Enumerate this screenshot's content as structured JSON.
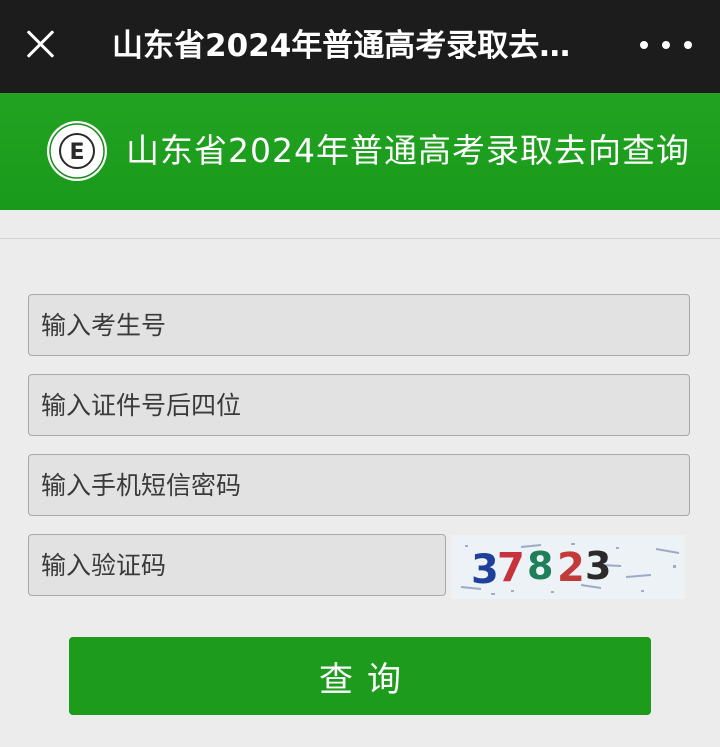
{
  "titlebar": {
    "title": "山东省2024年普通高考录取去…",
    "close_icon": "close-icon",
    "more_icon": "more-icon"
  },
  "banner": {
    "title": "山东省2024年普通高考录取去向查询",
    "logo_icon": "exam-authority-logo",
    "logo_letter": "E"
  },
  "form": {
    "exam_number_placeholder": "输入考生号",
    "id_last4_placeholder": "输入证件号后四位",
    "sms_password_placeholder": "输入手机短信密码",
    "captcha_placeholder": "输入验证码",
    "captcha_code": "37823",
    "submit_label": "查询"
  },
  "colors": {
    "titlebar": "#1c1c1c",
    "banner": "#1f9f1f",
    "button": "#1d9b1d",
    "page_background": "#ececec"
  }
}
